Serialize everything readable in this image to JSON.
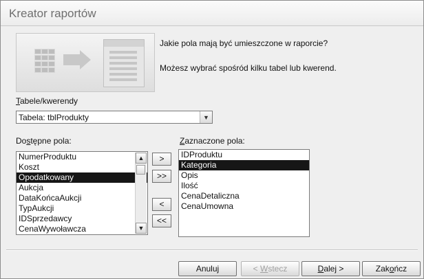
{
  "window": {
    "title": "Kreator raportów"
  },
  "intro": {
    "question": "Jakie pola mają być umieszczone w raporcie?",
    "hint": "Możesz wybrać spośród kilku tabel lub kwerend."
  },
  "source": {
    "label_mn": "T",
    "label_rest": "abele/kwerendy",
    "selected": "Tabela: tblProdukty",
    "dropdown_icon": "chevron-down-icon"
  },
  "available": {
    "label_pre": "Do",
    "label_mn": "s",
    "label_rest": "tępne pola:",
    "items": [
      "NumerProduktu",
      "Koszt",
      "Opodatkowany",
      "Aukcja",
      "DataKońcaAukcji",
      "TypAukcji",
      "IDSprzedawcy",
      "CenaWywoławcza"
    ],
    "selected_index": 2,
    "scroll_up_icon": "scroll-up-icon",
    "scroll_down_icon": "scroll-down-icon"
  },
  "selected": {
    "label_mn": "Z",
    "label_rest": "aznaczone pola:",
    "items": [
      "IDProduktu",
      "Kategoria",
      "Opis",
      "Ilość",
      "CenaDetaliczna",
      "CenaUmowna"
    ],
    "selected_index": 1
  },
  "move_buttons": {
    "add_one": ">",
    "add_all": ">>",
    "remove_one": "<",
    "remove_all": "<<"
  },
  "footer": {
    "cancel": "Anuluj",
    "back_pre": "< ",
    "back_mn": "W",
    "back_rest": "stecz",
    "next_mn": "D",
    "next_rest": "alej >",
    "finish_pre": "Zak",
    "finish_mn": "o",
    "finish_rest": "ńcz"
  }
}
